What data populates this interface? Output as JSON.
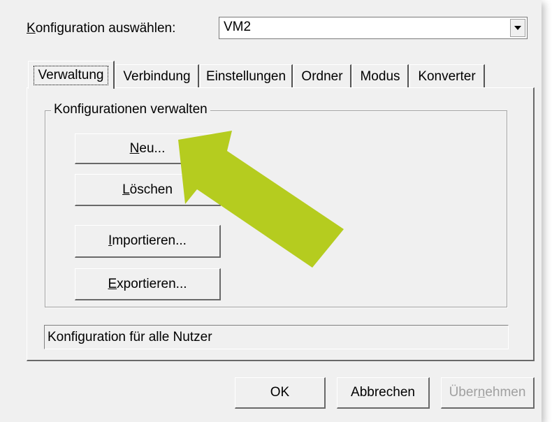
{
  "config": {
    "label_prefix": "K",
    "label_rest": "onfiguration auswählen:",
    "selected": "VM2"
  },
  "tabs": [
    {
      "label": "Verwaltung"
    },
    {
      "label": "Verbindung"
    },
    {
      "label": "Einstellungen"
    },
    {
      "label": "Ordner"
    },
    {
      "label": "Modus"
    },
    {
      "label": "Konverter"
    }
  ],
  "group": {
    "title": "Konfigurationen verwalten",
    "buttons": {
      "new": {
        "mn": "N",
        "rest": "eu..."
      },
      "delete": {
        "mn": "L",
        "rest": "öschen"
      },
      "import": {
        "mn": "I",
        "rest": "mportieren..."
      },
      "export": {
        "mn": "E",
        "rest": "xportieren..."
      }
    }
  },
  "status_text": "Konfiguration für alle Nutzer",
  "footer": {
    "ok": "OK",
    "cancel": "Abbrechen",
    "apply_pre": "Über",
    "apply_mn": "n",
    "apply_post": "ehmen"
  },
  "annotation": {
    "arrow_color": "#b5cc1f"
  }
}
